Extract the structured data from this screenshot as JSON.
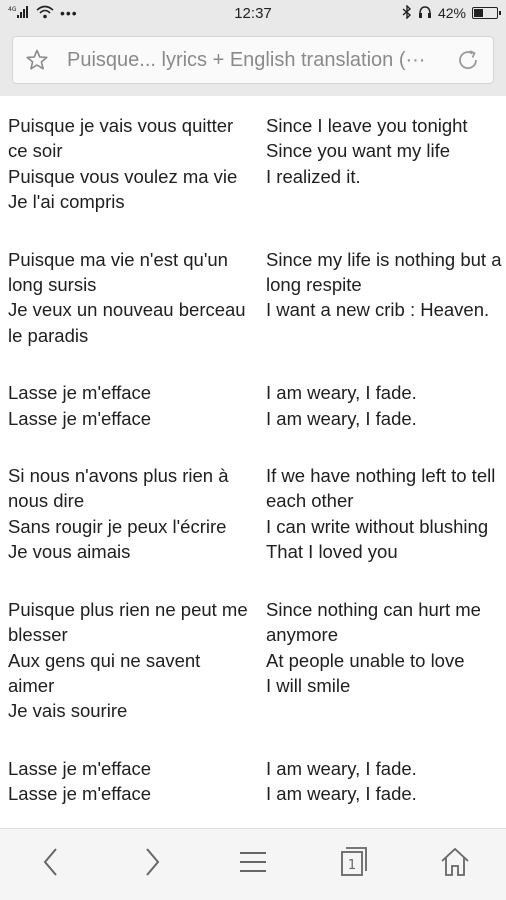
{
  "status_bar": {
    "signal_text": "4G",
    "time": "12:37",
    "battery_percent": "42%",
    "battery_level": 0.42
  },
  "address_bar": {
    "title": "Puisque... lyrics + English translation (···"
  },
  "lyrics": [
    {
      "fr": [
        "Puisque je vais vous quitter",
        "ce soir",
        "Puisque vous voulez ma vie",
        "Je l'ai compris"
      ],
      "en": [
        "Since I leave you tonight",
        "Since you want my life",
        "I realized it."
      ]
    },
    {
      "fr": [
        "Puisque ma vie n'est qu'un",
        "long sursis",
        "Je veux un nouveau berceau",
        "le paradis"
      ],
      "en": [
        "Since my life is nothing but a",
        "long respite",
        "I want a new crib : Heaven."
      ]
    },
    {
      "fr": [
        "Lasse je m'efface",
        "Lasse je m'efface"
      ],
      "en": [
        "I am weary, I fade.",
        "I am weary, I fade."
      ]
    },
    {
      "fr": [
        "Si nous n'avons plus rien à",
        "nous dire",
        "Sans rougir je peux l'écrire",
        "Je vous aimais"
      ],
      "en": [
        "If we have nothing left to tell",
        "each other",
        "I can write without blushing",
        "That I loved you"
      ]
    },
    {
      "fr": [
        "Puisque plus rien ne peut me",
        "blesser",
        "Aux gens qui ne savent",
        "aimer",
        "Je vais sourire"
      ],
      "en": [
        "Since nothing can hurt me",
        "anymore",
        "At people unable to love",
        "I will smile"
      ]
    },
    {
      "fr": [
        "Lasse je m'efface",
        "Lasse je m'efface"
      ],
      "en": [
        "I am weary, I fade.",
        "I am weary, I fade."
      ]
    }
  ],
  "bottom_nav": {
    "tab_count": "1",
    "icons": [
      "back-arrow-icon",
      "forward-arrow-icon",
      "menu-icon",
      "tabs-icon",
      "home-icon"
    ]
  }
}
